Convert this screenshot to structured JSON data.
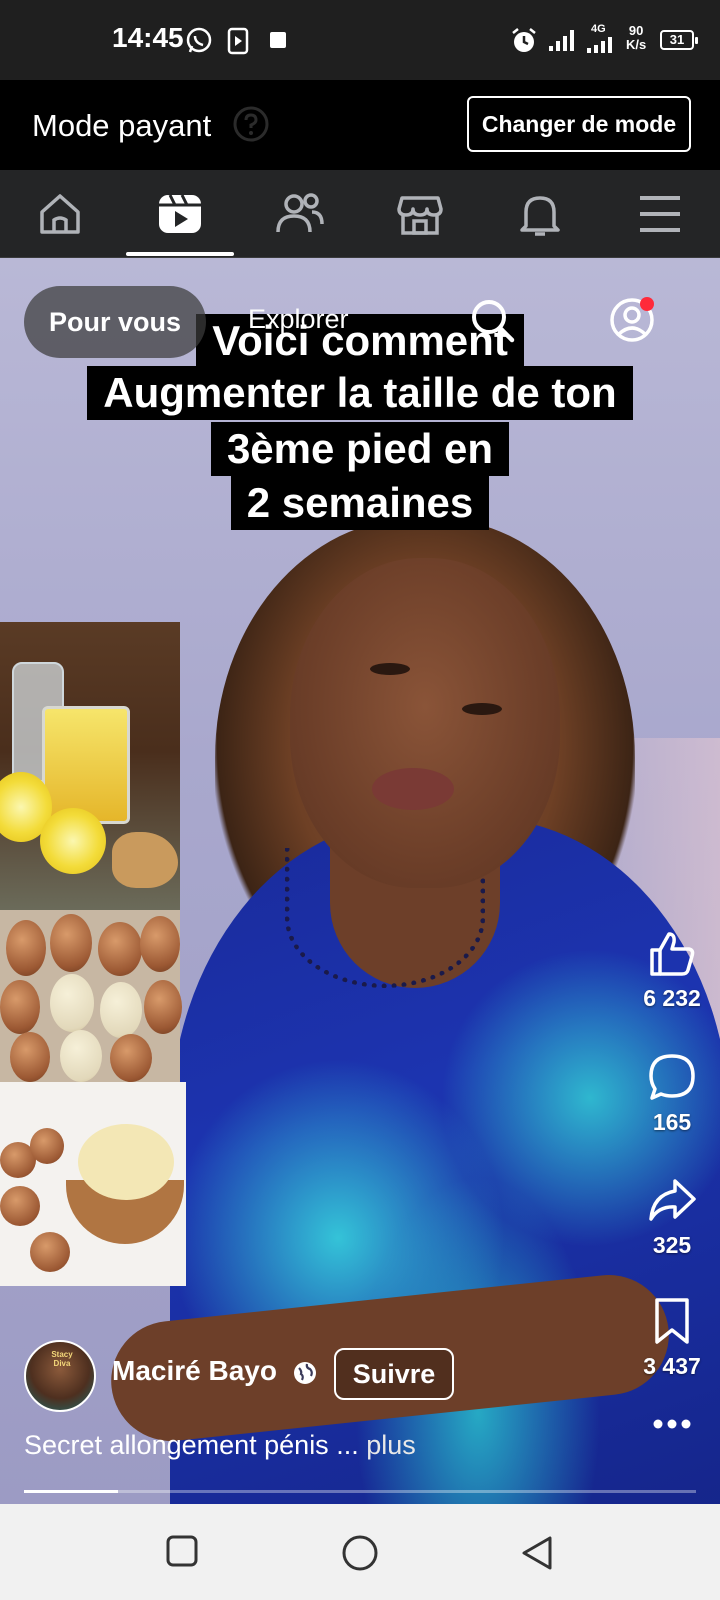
{
  "status_bar": {
    "time": "14:45",
    "network_tag": "4G",
    "net_speed_value": "90",
    "net_speed_unit": "K/s",
    "battery": "31",
    "icons": [
      "whatsapp-icon",
      "media-icon",
      "square-icon",
      "alarm-icon",
      "signal-icon",
      "signal-icon"
    ]
  },
  "mode_bar": {
    "title": "Mode payant",
    "button_label": "Changer de mode"
  },
  "nav": {
    "items": [
      "home-icon",
      "video-icon",
      "friends-icon",
      "marketplace-icon",
      "notifications-icon",
      "menu-icon"
    ],
    "active_index": 1
  },
  "video": {
    "tabs": {
      "active": "Pour vous",
      "other": "Explorer"
    },
    "caption": [
      "Voici comment",
      "Augmenter la taille de ton",
      "3ème pied en",
      "2 semaines"
    ],
    "actions": {
      "likes": "6 232",
      "comments": "165",
      "shares": "325",
      "saves": "3 437"
    },
    "author": {
      "name": "Maciré Bayo",
      "avatar_text": "Stacy Diva",
      "follow_label": "Suivre"
    },
    "description": "Secret allongement pénis ...",
    "more_label": "plus",
    "progress": 0.14
  },
  "colors": {
    "accent_red": "#ff2a3a",
    "nav_bg": "#242526",
    "status_bg": "#1f1f1f"
  }
}
